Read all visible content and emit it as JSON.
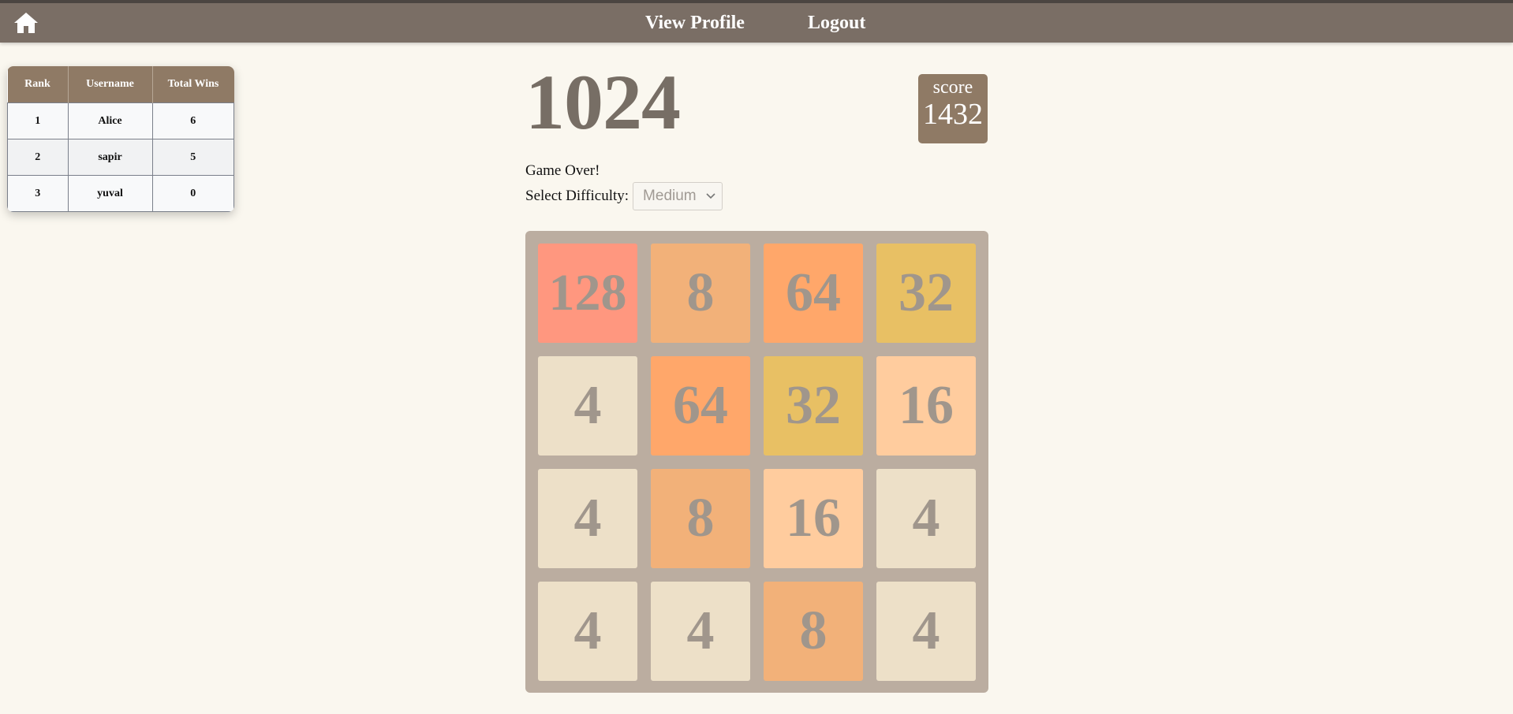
{
  "nav": {
    "home_icon": "home-icon",
    "view_profile": "View Profile",
    "logout": "Logout"
  },
  "leaderboard": {
    "headers": [
      "Rank",
      "Username",
      "Total Wins"
    ],
    "rows": [
      {
        "rank": "1",
        "username": "Alice",
        "wins": "6"
      },
      {
        "rank": "2",
        "username": "sapir",
        "wins": "5"
      },
      {
        "rank": "3",
        "username": "yuval",
        "wins": "0"
      }
    ]
  },
  "game": {
    "title": "1024",
    "score_label": "score",
    "score_value": "1432",
    "status": "Game Over!",
    "difficulty_label": "Select Difficulty:",
    "difficulty_selected": "Medium",
    "board": [
      [
        128,
        8,
        64,
        32
      ],
      [
        4,
        64,
        32,
        16
      ],
      [
        4,
        8,
        16,
        4
      ],
      [
        4,
        4,
        8,
        4
      ]
    ],
    "tile_colors": {
      "4": "#ede0c8",
      "8": "#f2b179",
      "16": "#ffcc9e",
      "32": "#e8c064",
      "64": "#ffa76a",
      "128": "#ff977f"
    },
    "board_color": "#bbada0",
    "text_color": "#776e65"
  }
}
